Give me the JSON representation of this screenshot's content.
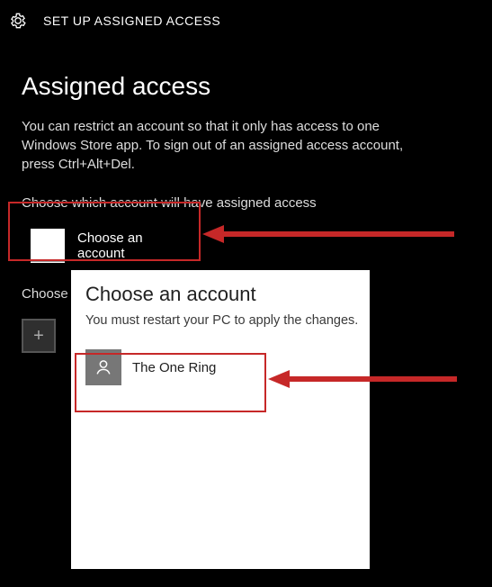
{
  "titlebar": {
    "text": "SET UP ASSIGNED ACCESS"
  },
  "page": {
    "title": "Assigned access",
    "description": "You can restrict an account so that it only has access to one Windows Store app. To sign out of an assigned access account, press Ctrl+Alt+Del.",
    "choose_account_label": "Choose which account will have assigned access",
    "choose_account_button": "Choose an account",
    "choose_partial": "Choose"
  },
  "popup": {
    "title": "Choose an account",
    "subtitle": "You must restart your PC to apply the changes.",
    "accounts": [
      {
        "name": "The One Ring"
      }
    ]
  },
  "annotations": {
    "color": "#c62828"
  }
}
